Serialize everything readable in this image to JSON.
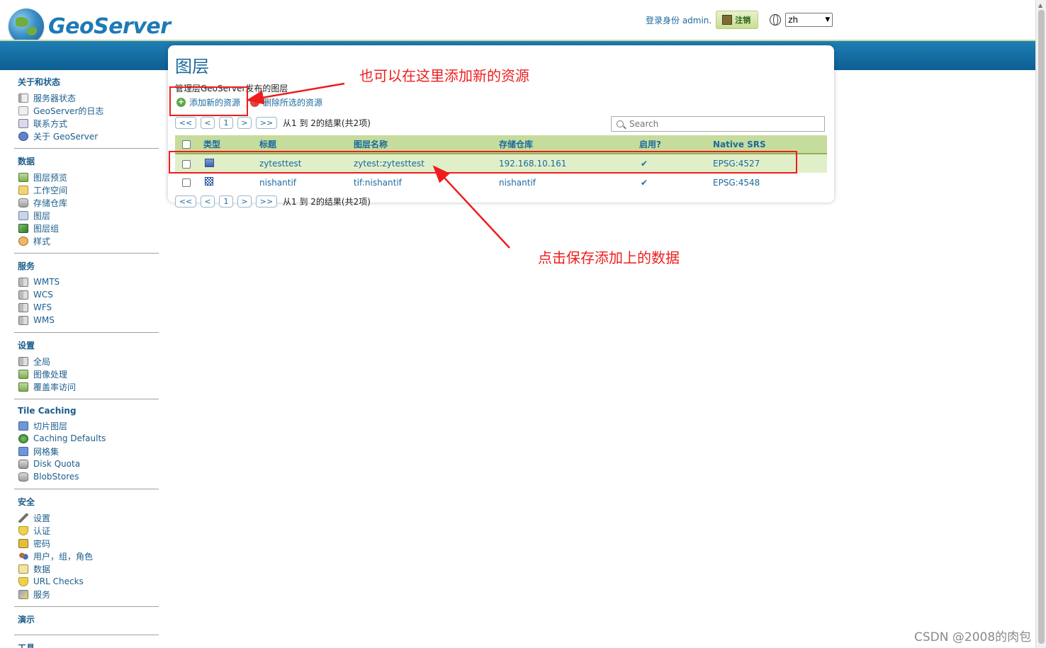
{
  "header": {
    "logo_text": "GeoServer",
    "login_label": "登录身份 admin.",
    "logout_label": "注销",
    "language": "zh"
  },
  "sidebar": {
    "sections": [
      {
        "title": "关于和状态",
        "items": [
          {
            "label": "服务器状态",
            "icon": "server-status-icon"
          },
          {
            "label": "GeoServer的日志",
            "icon": "log-icon"
          },
          {
            "label": "联系方式",
            "icon": "contact-icon"
          },
          {
            "label": "关于 GeoServer",
            "icon": "info-icon"
          }
        ]
      },
      {
        "title": "数据",
        "items": [
          {
            "label": "图层预览",
            "icon": "map-preview-icon"
          },
          {
            "label": "工作空间",
            "icon": "folder-icon"
          },
          {
            "label": "存储仓库",
            "icon": "database-icon"
          },
          {
            "label": "图层",
            "icon": "layer-icon"
          },
          {
            "label": "图层组",
            "icon": "layer-group-icon"
          },
          {
            "label": "样式",
            "icon": "style-icon"
          }
        ]
      },
      {
        "title": "服务",
        "items": [
          {
            "label": "WMTS",
            "icon": "service-icon"
          },
          {
            "label": "WCS",
            "icon": "service-icon"
          },
          {
            "label": "WFS",
            "icon": "service-icon"
          },
          {
            "label": "WMS",
            "icon": "service-icon"
          }
        ]
      },
      {
        "title": "设置",
        "items": [
          {
            "label": "全局",
            "icon": "global-settings-icon"
          },
          {
            "label": "图像处理",
            "icon": "image-processing-icon"
          },
          {
            "label": "覆盖率访问",
            "icon": "coverage-access-icon"
          }
        ]
      },
      {
        "title": "Tile Caching",
        "items": [
          {
            "label": "切片图层",
            "icon": "tile-layers-icon"
          },
          {
            "label": "Caching Defaults",
            "icon": "globe-defaults-icon"
          },
          {
            "label": "网格集",
            "icon": "gridset-icon"
          },
          {
            "label": "Disk Quota",
            "icon": "disk-icon"
          },
          {
            "label": "BlobStores",
            "icon": "blobstore-icon"
          }
        ]
      },
      {
        "title": "安全",
        "items": [
          {
            "label": "设置",
            "icon": "wrench-icon"
          },
          {
            "label": "认证",
            "icon": "shield-icon"
          },
          {
            "label": "密码",
            "icon": "lock-icon"
          },
          {
            "label": "用户，组，角色",
            "icon": "users-icon"
          },
          {
            "label": "数据",
            "icon": "data-security-icon"
          },
          {
            "label": "URL Checks",
            "icon": "url-checks-icon"
          },
          {
            "label": "服务",
            "icon": "service-security-icon"
          }
        ]
      },
      {
        "title": "演示",
        "items": []
      },
      {
        "title": "工具",
        "items": []
      }
    ]
  },
  "main": {
    "title": "图层",
    "description": "管理层GeoServer发布的图层",
    "add_label": "添加新的资源",
    "remove_label": "删除所选的资源",
    "pager": {
      "first": "<<",
      "prev": "<",
      "page": "1",
      "next": ">",
      "last": ">>",
      "info": "从1 到 2的结果(共2项)"
    },
    "search_placeholder": "Search",
    "columns": [
      "类型",
      "标题",
      "图层名称",
      "存储仓库",
      "启用?",
      "Native SRS"
    ],
    "rows": [
      {
        "type": "vector",
        "title": "zytesttest",
        "name": "zytest:zytesttest",
        "store": "192.168.10.161",
        "enabled": "✔",
        "srs": "EPSG:4527"
      },
      {
        "type": "raster",
        "title": "nishantif",
        "name": "tif:nishantif",
        "store": "nishantif",
        "enabled": "✔",
        "srs": "EPSG:4548"
      }
    ]
  },
  "annotations": {
    "add_note": "也可以在这里添加新的资源",
    "save_note": "点击保存添加上的数据"
  },
  "watermark": "CSDN @2008的肉包",
  "colors": {
    "accent": "#1b6a9c",
    "header_bar": "#0d5e92",
    "table_header": "#c6dc9c",
    "annotation": "#ee1d1d"
  }
}
